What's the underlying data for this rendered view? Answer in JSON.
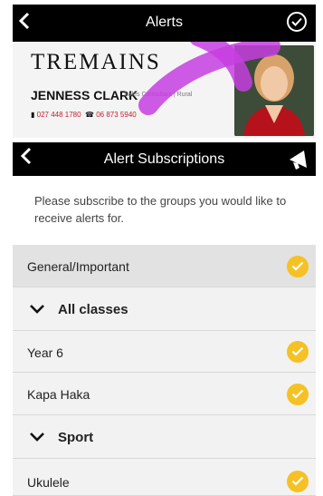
{
  "header": {
    "back_label": "<",
    "title": "Alerts"
  },
  "banner": {
    "brand": "TREMAINS",
    "agent_name": "JENNESS CLARK",
    "agent_role": "Sales Consultant | Rural",
    "phone_mobile": "027 448 1780",
    "phone_landline": "06 873 5940"
  },
  "subscriptions_header": {
    "back_label": "<",
    "title": "Alert Subscriptions"
  },
  "intro_text": "Please subscribe to the groups you would like to receive alerts for.",
  "rows": [
    {
      "label": "General/Important",
      "type": "item",
      "subscribed": true,
      "selected": true
    },
    {
      "label": "All classes",
      "type": "group"
    },
    {
      "label": "Year 6",
      "type": "item",
      "subscribed": true
    },
    {
      "label": "Kapa Haka",
      "type": "item",
      "subscribed": true
    },
    {
      "label": "Sport",
      "type": "group"
    },
    {
      "label": "Ukulele",
      "type": "item",
      "subscribed": true
    }
  ],
  "colors": {
    "accent": "#f5c125",
    "bar": "#000000",
    "list_bg": "#f2f2f2",
    "swirl": "#c63ee0",
    "phone_text": "#c4202f"
  }
}
